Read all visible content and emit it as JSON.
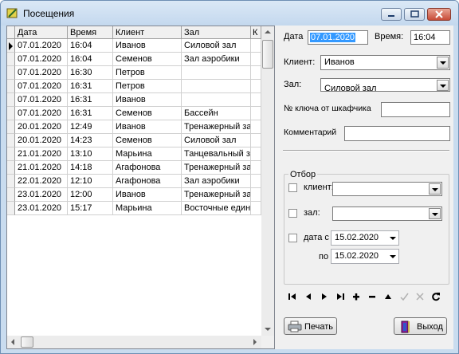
{
  "window": {
    "title": "Посещения"
  },
  "grid": {
    "columns": [
      "Дата",
      "Время",
      "Клиент",
      "Зал",
      "К"
    ],
    "rows": [
      [
        "07.01.2020",
        "16:04",
        "Иванов",
        "Силовой зал"
      ],
      [
        "07.01.2020",
        "16:04",
        "Семенов",
        "Зал аэробики"
      ],
      [
        "07.01.2020",
        "16:30",
        "Петров",
        ""
      ],
      [
        "07.01.2020",
        "16:31",
        "Петров",
        ""
      ],
      [
        "07.01.2020",
        "16:31",
        "Иванов",
        ""
      ],
      [
        "07.01.2020",
        "16:31",
        "Семенов",
        "Бассейн"
      ],
      [
        "20.01.2020",
        "12:49",
        "Иванов",
        "Тренажерный зал"
      ],
      [
        "20.01.2020",
        "14:23",
        "Семенов",
        "Силовой зал"
      ],
      [
        "21.01.2020",
        "13:10",
        "Марьина",
        "Танцевальный зал"
      ],
      [
        "21.01.2020",
        "14:18",
        "Агафонова",
        "Тренажерный зал"
      ],
      [
        "22.01.2020",
        "12:10",
        "Агафонова",
        "Зал аэробики"
      ],
      [
        "23.01.2020",
        "12:00",
        "Иванов",
        "Тренажерный зал"
      ],
      [
        "23.01.2020",
        "15:17",
        "Марьина",
        "Восточные едино"
      ]
    ]
  },
  "form": {
    "date_label": "Дата",
    "date_value": "07.01.2020",
    "time_label": "Время:",
    "time_value": "16:04",
    "client_label": "Клиент:",
    "client_value": "Иванов",
    "hall_label": "Зал:",
    "hall_value": "Силовой зал",
    "locker_label": "№ ключа от шкафчика",
    "locker_value": "",
    "comment_label": "Комментарий",
    "comment_value": ""
  },
  "filter": {
    "group_label": "Отбор",
    "client_label": "клиент:",
    "client_value": "",
    "hall_label": "зал:",
    "hall_value": "",
    "date_from_label": "дата с",
    "date_from": "15.02.2020",
    "date_to_label": "по",
    "date_to": "15.02.2020"
  },
  "buttons": {
    "print": "Печать",
    "exit": "Выход"
  },
  "colors": {
    "selection": "#3399ff",
    "title_bg": "#c9dcef",
    "close": "#c74b37"
  }
}
